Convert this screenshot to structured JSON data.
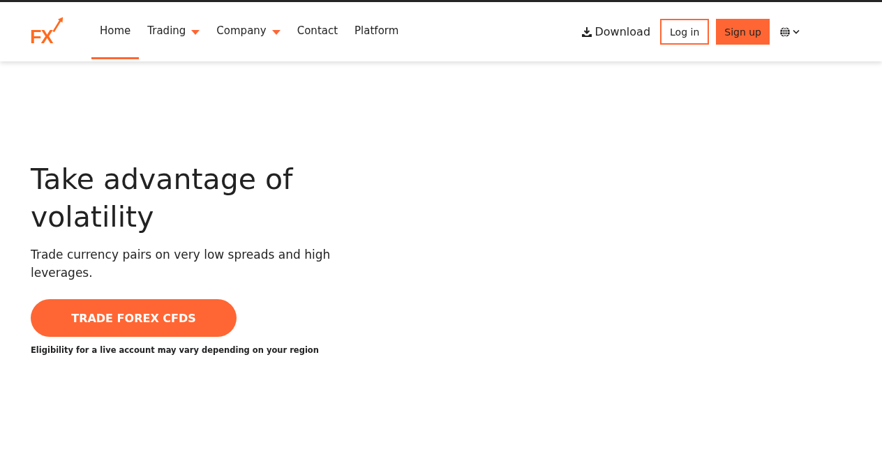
{
  "logo": {
    "text": "FX"
  },
  "nav": [
    {
      "label": "Home",
      "selected": true,
      "dropdown": false
    },
    {
      "label": "Trading",
      "selected": false,
      "dropdown": true
    },
    {
      "label": "Company",
      "selected": false,
      "dropdown": true
    },
    {
      "label": "Contact",
      "selected": false,
      "dropdown": false
    },
    {
      "label": "Platform",
      "selected": false,
      "dropdown": false
    }
  ],
  "download": {
    "label": "Download"
  },
  "login": {
    "label": "Log in"
  },
  "signup": {
    "label": "Sign up"
  },
  "hero": {
    "title": "Take advantage of volatility",
    "subtitle": "Trade currency pairs on very low spreads and high leverages.",
    "cta": "TRADE FOREX CFDS",
    "note": "Eligibility for a live account may vary depending on your region"
  }
}
